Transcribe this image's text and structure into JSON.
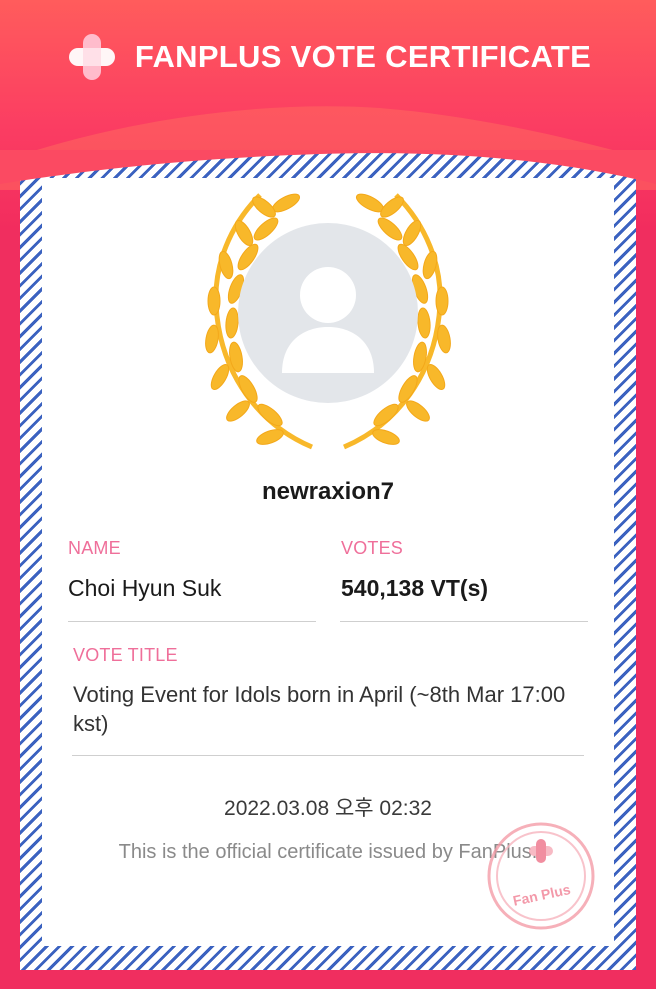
{
  "header": {
    "title": "FANPLUS VOTE CERTIFICATE",
    "logo_icon": "fanplus-logo-icon"
  },
  "profile": {
    "username": "newraxion7",
    "avatar_icon": "default-user-avatar-icon",
    "laurel_icon": "gold-laurel-wreath-icon"
  },
  "fields": {
    "name_label": "NAME",
    "name_value": "Choi Hyun Suk",
    "votes_label": "VOTES",
    "votes_value": "540,138 VT(s)",
    "vote_title_label": "VOTE TITLE",
    "vote_title_value": "Voting Event for Idols born in April (~8th Mar 17:00 kst)"
  },
  "issued_at": "2022.03.08 오후 02:32",
  "footer_text": "This is the official certificate issued by FanPlus.",
  "stamp": {
    "text": "Fan Plus",
    "icon": "fanplus-stamp-icon"
  },
  "colors": {
    "brand_pink": "#f02e5f",
    "label_pink": "#ef6f9a",
    "laurel_gold": "#f8b82a",
    "border_blue": "#3b62c0"
  }
}
